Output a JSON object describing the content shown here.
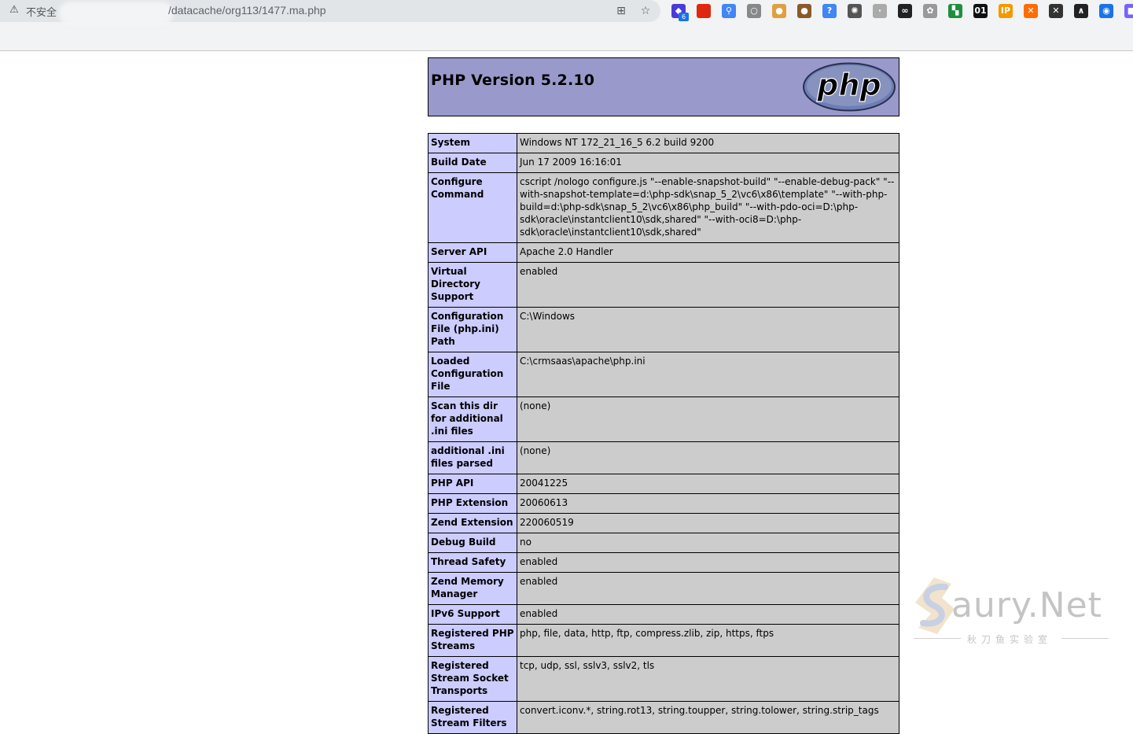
{
  "browser": {
    "insecure_label": "不安全",
    "url_path": "/datacache/org113/1477.ma.php",
    "extension_badge": "6",
    "extensions": [
      {
        "name": "ext-1",
        "glyph": "◆",
        "color": "#4a3bd8"
      },
      {
        "name": "ext-flag",
        "glyph": "",
        "color": "#de2910"
      },
      {
        "name": "ext-pin",
        "glyph": "⚲",
        "color": "#4285f4"
      },
      {
        "name": "ext-circle",
        "glyph": "○",
        "color": "#888888"
      },
      {
        "name": "ext-cookie",
        "glyph": "●",
        "color": "#e0a040"
      },
      {
        "name": "ext-cookie-2",
        "glyph": "●",
        "color": "#8a5a2b"
      },
      {
        "name": "ext-help",
        "glyph": "?",
        "color": "#4285f4"
      },
      {
        "name": "ext-gear",
        "glyph": "✺",
        "color": "#555555"
      },
      {
        "name": "ext-small",
        "glyph": "·",
        "color": "#aaaaaa"
      },
      {
        "name": "ext-glasses",
        "glyph": "∞",
        "color": "#222222"
      },
      {
        "name": "ext-flower",
        "glyph": "✿",
        "color": "#999999"
      },
      {
        "name": "ext-green",
        "glyph": "▚",
        "color": "#1e8e3e"
      },
      {
        "name": "ext-01",
        "glyph": "01",
        "color": "#111111"
      },
      {
        "name": "ext-ip",
        "glyph": "IP",
        "color": "#f29900"
      },
      {
        "name": "ext-orange",
        "glyph": "✕",
        "color": "#ff6d00"
      },
      {
        "name": "ext-x",
        "glyph": "✕",
        "color": "#333333"
      },
      {
        "name": "ext-cat",
        "glyph": "∧",
        "color": "#222222"
      },
      {
        "name": "ext-globe",
        "glyph": "◉",
        "color": "#1a73e8"
      },
      {
        "name": "ext-purple",
        "glyph": "■",
        "color": "#7b61ff"
      }
    ]
  },
  "phpinfo": {
    "title": "PHP Version 5.2.10",
    "logo_text": "php",
    "rows": [
      {
        "label": "System",
        "value": "Windows NT 172_21_16_5 6.2 build 9200"
      },
      {
        "label": "Build Date",
        "value": "Jun 17 2009 16:16:01"
      },
      {
        "label": "Configure Command",
        "value": "cscript /nologo configure.js \"--enable-snapshot-build\" \"--enable-debug-pack\" \"--with-snapshot-template=d:\\php-sdk\\snap_5_2\\vc6\\x86\\template\" \"--with-php-build=d:\\php-sdk\\snap_5_2\\vc6\\x86\\php_build\" \"--with-pdo-oci=D:\\php-sdk\\oracle\\instantclient10\\sdk,shared\" \"--with-oci8=D:\\php-sdk\\oracle\\instantclient10\\sdk,shared\""
      },
      {
        "label": "Server API",
        "value": "Apache 2.0 Handler"
      },
      {
        "label": "Virtual Directory Support",
        "value": "enabled"
      },
      {
        "label": "Configuration File (php.ini) Path",
        "value": "C:\\Windows"
      },
      {
        "label": "Loaded Configuration File",
        "value": "C:\\crmsaas\\apache\\php.ini"
      },
      {
        "label": "Scan this dir for additional .ini files",
        "value": "(none)"
      },
      {
        "label": "additional .ini files parsed",
        "value": "(none)"
      },
      {
        "label": "PHP API",
        "value": "20041225"
      },
      {
        "label": "PHP Extension",
        "value": "20060613"
      },
      {
        "label": "Zend Extension",
        "value": "220060519"
      },
      {
        "label": "Debug Build",
        "value": "no"
      },
      {
        "label": "Thread Safety",
        "value": "enabled"
      },
      {
        "label": "Zend Memory Manager",
        "value": "enabled"
      },
      {
        "label": "IPv6 Support",
        "value": "enabled"
      },
      {
        "label": "Registered PHP Streams",
        "value": "php, file, data, http, ftp, compress.zlib, zip, https, ftps"
      },
      {
        "label": "Registered Stream Socket Transports",
        "value": "tcp, udp, ssl, sslv3, sslv2, tls"
      },
      {
        "label": "Registered Stream Filters",
        "value": "convert.iconv.*, string.rot13, string.toupper, string.tolower, string.strip_tags"
      }
    ]
  },
  "watermark": {
    "brand": "aury.Net",
    "subtitle": "秋刀鱼实验室"
  }
}
